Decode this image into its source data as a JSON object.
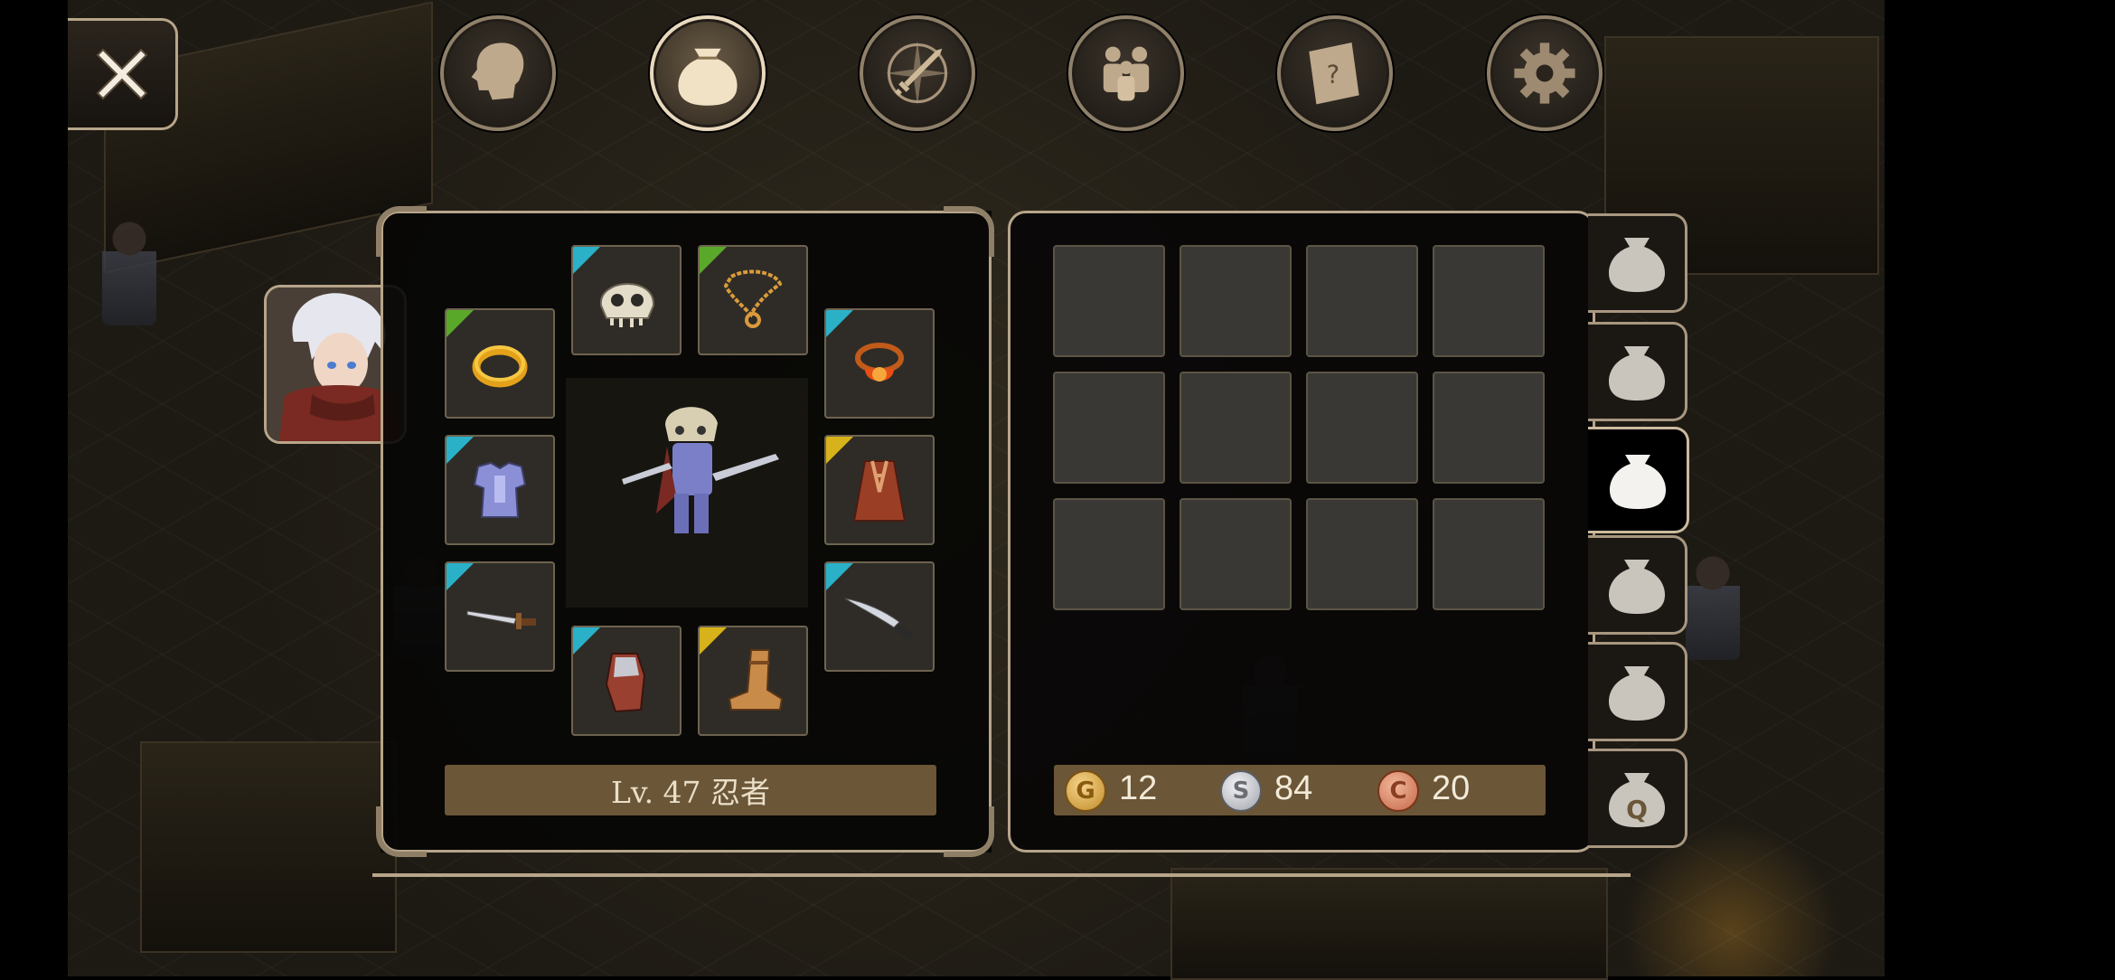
{
  "top_tabs": [
    {
      "name": "character",
      "icon": "head-profile-icon",
      "active": false
    },
    {
      "name": "inventory",
      "icon": "money-bag-icon",
      "active": true
    },
    {
      "name": "skills",
      "icon": "sword-compass-icon",
      "active": false
    },
    {
      "name": "party",
      "icon": "people-icon",
      "active": false
    },
    {
      "name": "quests",
      "icon": "scroll-question-icon",
      "active": false
    },
    {
      "name": "settings",
      "icon": "gear-icon",
      "active": false
    }
  ],
  "character": {
    "level_text": "Lv. 47 忍者"
  },
  "equipment": [
    {
      "slot": "ring-left",
      "icon": "gold-ring-icon",
      "rarity": "green"
    },
    {
      "slot": "helmet",
      "icon": "skull-helmet-icon",
      "rarity": "cyan"
    },
    {
      "slot": "necklace",
      "icon": "chain-necklace-icon",
      "rarity": "green"
    },
    {
      "slot": "ring-right",
      "icon": "red-gem-ring-icon",
      "rarity": "cyan"
    },
    {
      "slot": "armor",
      "icon": "plate-armor-icon",
      "rarity": "cyan"
    },
    {
      "slot": "cloak",
      "icon": "cloak-icon",
      "rarity": "yellow"
    },
    {
      "slot": "main-weapon",
      "icon": "dagger-icon",
      "rarity": "cyan"
    },
    {
      "slot": "off-weapon",
      "icon": "knife-icon",
      "rarity": "cyan"
    },
    {
      "slot": "gloves",
      "icon": "gauntlet-icon",
      "rarity": "cyan"
    },
    {
      "slot": "boots",
      "icon": "boot-icon",
      "rarity": "yellow"
    }
  ],
  "inventory": {
    "rows": 3,
    "cols": 4,
    "slots_filled": 0
  },
  "currency": {
    "gold": {
      "label": "G",
      "value": "12"
    },
    "silver": {
      "label": "S",
      "value": "84"
    },
    "copper": {
      "label": "C",
      "value": "20"
    }
  },
  "bag_tabs": [
    {
      "icon": "bag-icon",
      "active": false
    },
    {
      "icon": "bag-icon",
      "active": false
    },
    {
      "icon": "bag-icon",
      "active": true
    },
    {
      "icon": "bag-icon",
      "active": false
    },
    {
      "icon": "bag-icon",
      "active": false
    },
    {
      "icon": "quest-bag-icon",
      "label": "Q",
      "active": false
    }
  ],
  "colors": {
    "rarity_cyan": "#2ab1c8",
    "rarity_green": "#5aa82a",
    "rarity_yellow": "#d7b21a",
    "frame": "#b7a58a",
    "bar_fill": "#6b5637"
  }
}
